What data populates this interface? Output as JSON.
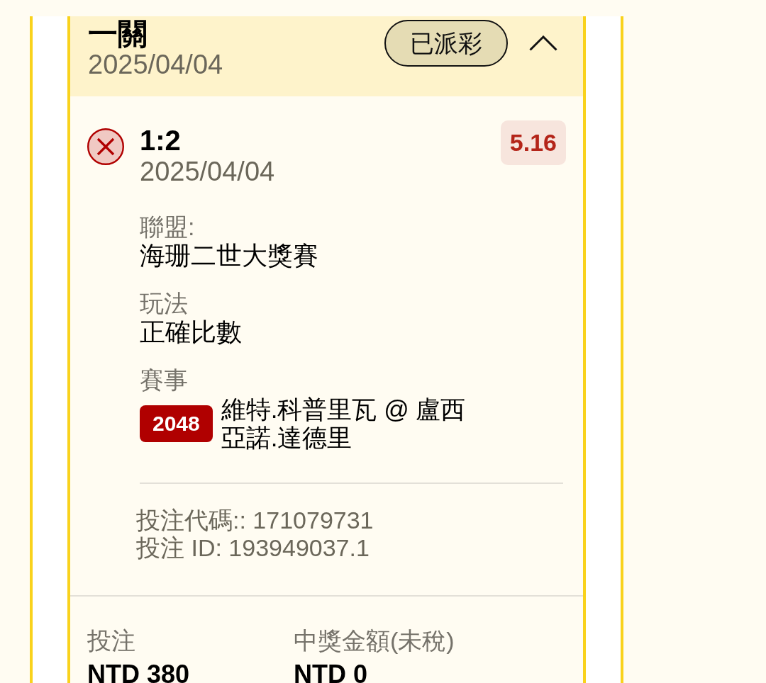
{
  "bet_card": {
    "title": "一關",
    "date": "2025/04/04",
    "status": "已派彩",
    "expanded": true,
    "selections": [
      {
        "won": false,
        "score": "1:2",
        "date": "2025/04/04",
        "odds": "5.16",
        "fields": [
          {
            "label": "聯盟:",
            "value": "海珊二世大獎賽"
          },
          {
            "label": "玩法",
            "value": "正確比數"
          }
        ],
        "match": {
          "label": "賽事",
          "number": "2048",
          "teams": "維特.科普里瓦 @ 盧西亞諾.達德里"
        },
        "bet_code": "投注代碼:: 171079731",
        "bet_id": "投注 ID: 193949037.1"
      }
    ],
    "summary": [
      {
        "label": "投注",
        "value": "NTD 380"
      },
      {
        "label": "中獎金額(未稅)",
        "value": "NTD 0"
      }
    ]
  }
}
